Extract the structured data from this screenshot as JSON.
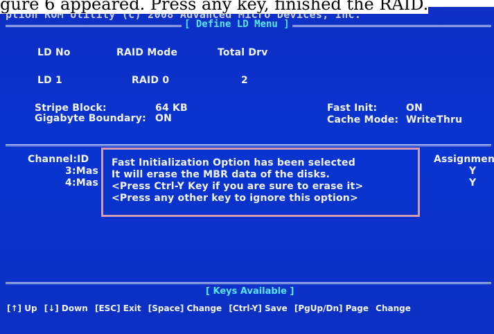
{
  "caption": "gure 6 appeared. Press any key, finished the RAID.",
  "utility_title": "ption ROM Utility (c) 2008 Advanced Micro Devices, Inc.",
  "menu_title": "[ Define LD Menu ]",
  "ld_table": {
    "headers": {
      "ld_no": "LD No",
      "raid_mode": "RAID Mode",
      "total_drv": "Total Drv"
    },
    "row": {
      "ld_no": "LD  1",
      "raid_mode": "RAID 0",
      "total_drv": "2"
    }
  },
  "settings": {
    "stripe_block_label": "Stripe Block:",
    "stripe_block_value": "64  KB",
    "gigabyte_boundary_label": "Gigabyte Boundary:",
    "gigabyte_boundary_value": "ON",
    "fast_init_label": "Fast Init:",
    "fast_init_value": "ON",
    "cache_mode_label": "Cache Mode:",
    "cache_mode_value": "WriteThru"
  },
  "channels": {
    "header": "Channel:ID",
    "items": [
      "3:Mas",
      "4:Mas"
    ],
    "assignment_header": "Assignment",
    "assignment_values": [
      "Y",
      "Y"
    ]
  },
  "dialog": {
    "lines": [
      "Fast Initialization Option has been selected",
      "It will erase the MBR data of the disks.",
      "<Press Ctrl-Y Key if you are sure to erase it>",
      "<Press any other key to ignore this option>"
    ]
  },
  "keys_title": "[ Keys Available ]",
  "keys": [
    "[↑] Up",
    "[↓] Down",
    "[ESC] Exit",
    "[Space] Change",
    "[Ctrl-Y] Save",
    "[PgUp/Dn] Page",
    "Change"
  ],
  "colors": {
    "screen_blue": "#0a34d0",
    "text_white": "#f2f4ff",
    "title_cyan": "#56e6ff",
    "dialog_border_pink": "#d39ab6"
  }
}
